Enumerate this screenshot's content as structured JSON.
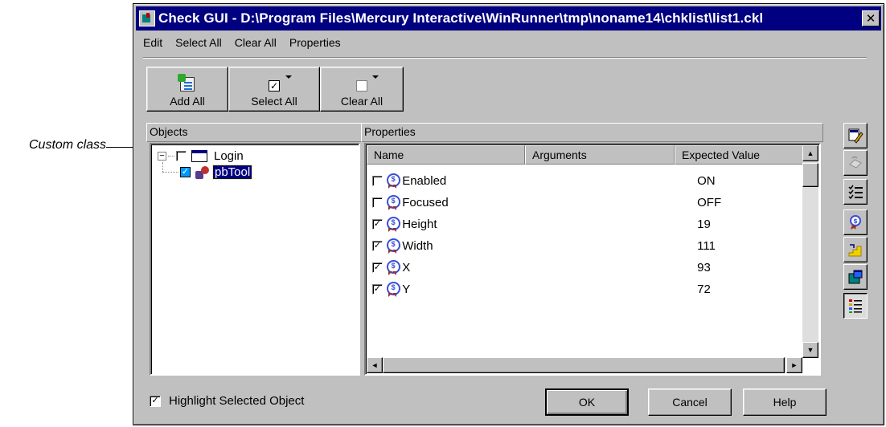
{
  "annotation": {
    "callout": "Custom class"
  },
  "window": {
    "title": "Check GUI - D:\\Program Files\\Mercury Interactive\\WinRunner\\tmp\\noname14\\chklist\\list1.ckl",
    "close_glyph": "✕"
  },
  "menu": [
    {
      "label": "Edit"
    },
    {
      "label": "Select All"
    },
    {
      "label": "Clear All"
    },
    {
      "label": "Properties"
    }
  ],
  "toolbar": {
    "add_all": "Add All",
    "select_all": "Select All",
    "clear_all": "Clear All",
    "check_glyph": "✓"
  },
  "objects_panel": {
    "label": "Objects",
    "tree": [
      {
        "label": "Login",
        "expander": "−",
        "checked": false
      },
      {
        "label": "pbTool",
        "checked": true,
        "selected": true
      }
    ]
  },
  "properties_panel": {
    "label": "Properties",
    "columns": {
      "name": "Name",
      "arguments": "Arguments",
      "expected": "Expected Value"
    },
    "rows": [
      {
        "name": "Enabled",
        "value": "ON",
        "checked": false
      },
      {
        "name": "Focused",
        "value": "OFF",
        "checked": false
      },
      {
        "name": "Height",
        "value": "19",
        "checked": true
      },
      {
        "name": "Width",
        "value": "111",
        "checked": true
      },
      {
        "name": "X",
        "value": "93",
        "checked": true
      },
      {
        "name": "Y",
        "value": "72",
        "checked": true
      }
    ]
  },
  "scroll_glyphs": {
    "up": "▲",
    "down": "▼",
    "left": "◄",
    "right": "►"
  },
  "highlight": {
    "label": "Highlight Selected Object",
    "checked": true
  },
  "buttons": {
    "ok": "OK",
    "cancel": "Cancel",
    "help": "Help"
  },
  "colors": {
    "title_bar": "#000080",
    "window_face": "#c0c0c0",
    "selection": "#000080",
    "checked_box": "#0099ff"
  }
}
